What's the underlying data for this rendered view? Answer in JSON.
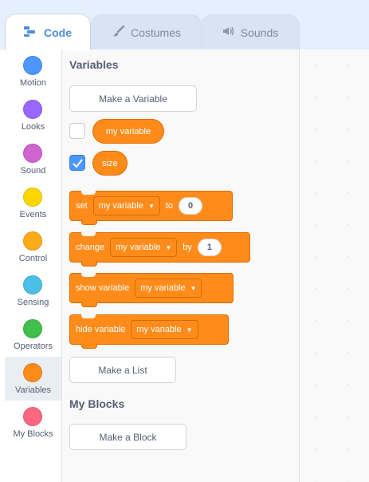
{
  "tabs": [
    {
      "label": "Code",
      "icon": "code-icon"
    },
    {
      "label": "Costumes",
      "icon": "brush-icon"
    },
    {
      "label": "Sounds",
      "icon": "speaker-icon"
    }
  ],
  "categories": [
    {
      "label": "Motion",
      "color": "#4c97ff"
    },
    {
      "label": "Looks",
      "color": "#9966ff"
    },
    {
      "label": "Sound",
      "color": "#cf63cf"
    },
    {
      "label": "Events",
      "color": "#ffd500"
    },
    {
      "label": "Control",
      "color": "#ffab19"
    },
    {
      "label": "Sensing",
      "color": "#4cbfe6"
    },
    {
      "label": "Operators",
      "color": "#40bf4a"
    },
    {
      "label": "Variables",
      "color": "#ff8c1a"
    },
    {
      "label": "My Blocks",
      "color": "#ff6680"
    }
  ],
  "selected_category": "Variables",
  "palette": {
    "variables_heading": "Variables",
    "make_variable_button": "Make a Variable",
    "variable_reporters": [
      {
        "label": "my variable",
        "checked": false
      },
      {
        "label": "size",
        "checked": true
      }
    ],
    "set_block": {
      "label": "set",
      "dropdown": "my variable",
      "connector": "to",
      "value": "0"
    },
    "change_block": {
      "label": "change",
      "dropdown": "my variable",
      "connector": "by",
      "value": "1"
    },
    "show_block": {
      "label": "show variable",
      "dropdown": "my variable"
    },
    "hide_block": {
      "label": "hide variable",
      "dropdown": "my variable"
    },
    "make_list_button": "Make a List",
    "my_blocks_heading": "My Blocks",
    "make_block_button": "Make a Block"
  },
  "colors": {
    "accent": "#4c97ff",
    "variables": "#ff8c1a"
  }
}
